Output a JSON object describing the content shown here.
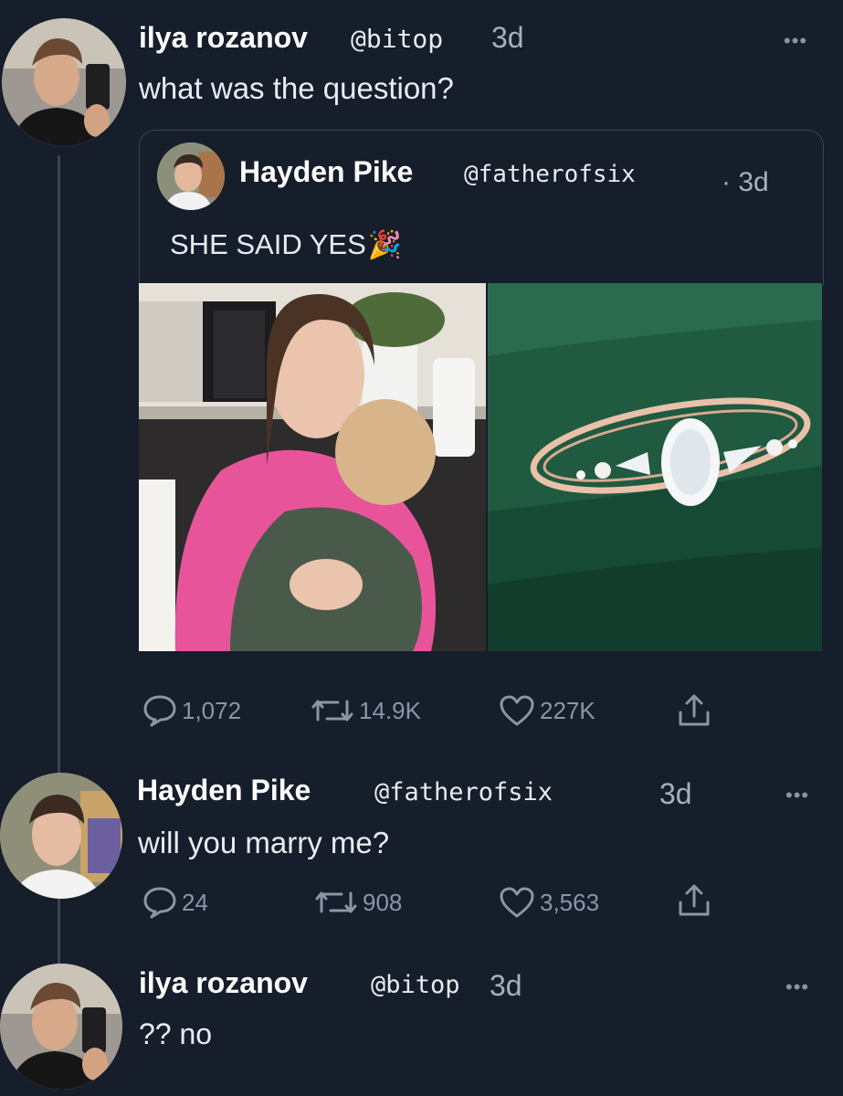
{
  "posts": [
    {
      "author_name": "ilya rozanov",
      "handle": "@bitop",
      "time": "3d",
      "text": "what was the question?",
      "more_label": "•••"
    },
    {
      "author_name": "Hayden Pike",
      "handle": "@fatherofsix",
      "time": "3d",
      "text": "will you marry me?",
      "more_label": "•••",
      "actions": {
        "replies": "24",
        "reposts": "908",
        "likes": "3,563"
      }
    },
    {
      "author_name": "ilya rozanov",
      "handle": "@bitop",
      "time": "3d",
      "text": "?? no",
      "more_label": "•••"
    }
  ],
  "quoted": {
    "author_name": "Hayden Pike",
    "handle": "@fatherofsix",
    "time": "· 3d",
    "text": "SHE SAID YES",
    "emoji": "🎉",
    "actions": {
      "replies": "1,072",
      "reposts": "14.9K",
      "likes": "227K"
    }
  },
  "icons": {
    "reply": "speech-bubble-icon",
    "repost": "repost-arrows-icon",
    "like": "heart-icon",
    "share": "share-icon",
    "more": "more-dots-icon"
  },
  "colors": {
    "background": "#161d2b",
    "text": "#ffffff",
    "muted": "#8b95a5",
    "pink_shirt": "#e8549a",
    "velvet_green": "#1f5a41"
  }
}
